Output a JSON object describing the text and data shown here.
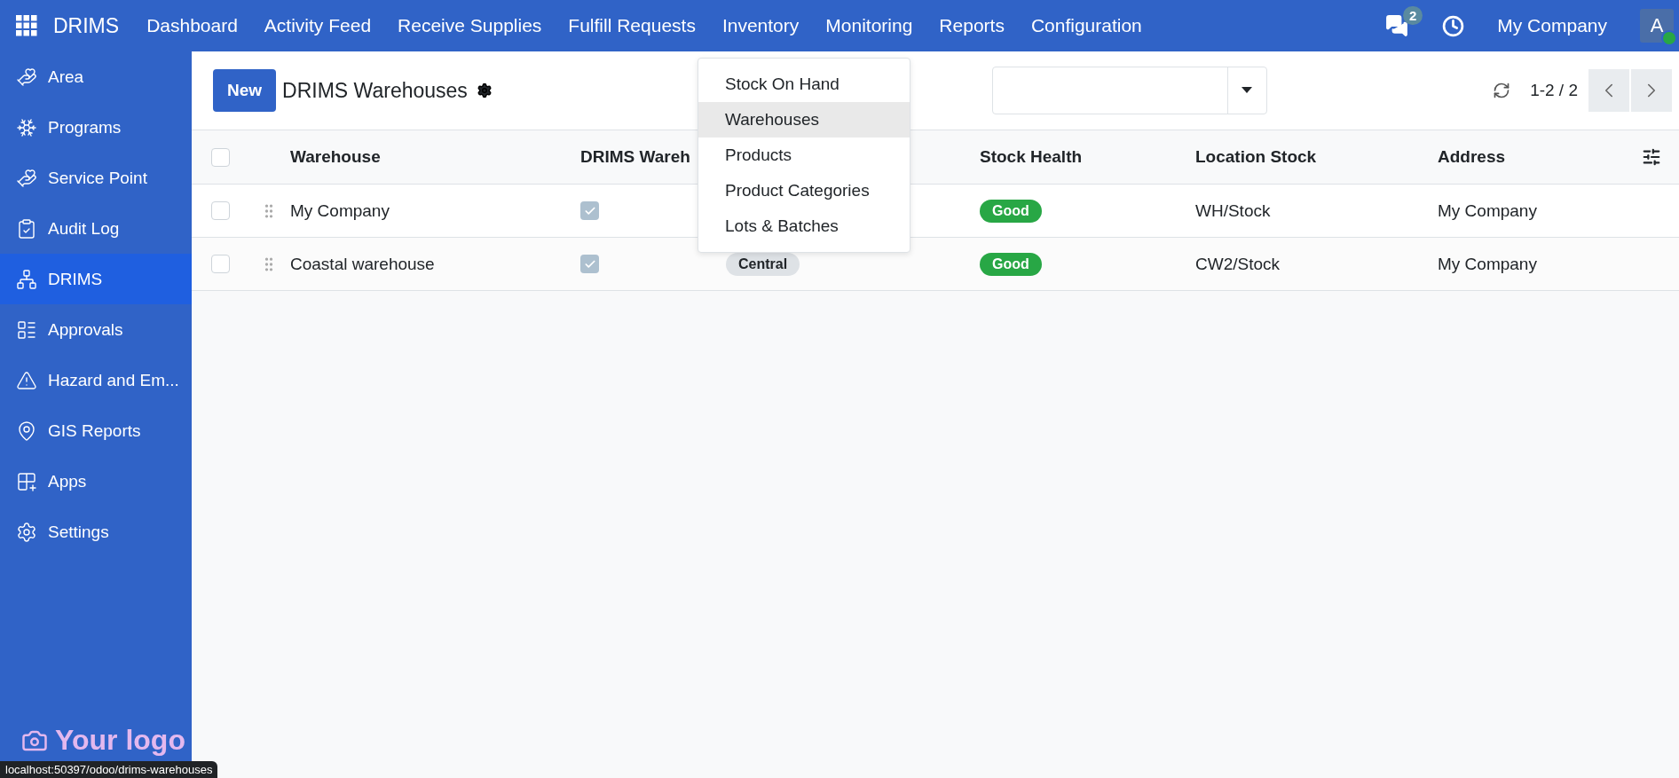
{
  "navbar": {
    "app_name": "DRIMS",
    "menu": [
      "Dashboard",
      "Activity Feed",
      "Receive Supplies",
      "Fulfill Requests",
      "Inventory",
      "Monitoring",
      "Reports",
      "Configuration"
    ],
    "message_count": "2",
    "company": "My Company",
    "avatar": "A"
  },
  "sidebar": {
    "items": [
      {
        "label": "Area",
        "selected": false
      },
      {
        "label": "Programs",
        "selected": false
      },
      {
        "label": "Service Point",
        "selected": false
      },
      {
        "label": "Audit Log",
        "selected": false
      },
      {
        "label": "DRIMS",
        "selected": true
      },
      {
        "label": "Approvals",
        "selected": false
      },
      {
        "label": "Hazard and Em...",
        "selected": false
      },
      {
        "label": "GIS Reports",
        "selected": false
      },
      {
        "label": "Apps",
        "selected": false
      },
      {
        "label": "Settings",
        "selected": false
      }
    ],
    "logo": "Your logo"
  },
  "control_panel": {
    "new_button": "New",
    "title": "DRIMS Warehouses",
    "pager": "1-2 / 2"
  },
  "dropdown": {
    "items": [
      {
        "label": "Stock On Hand",
        "selected": false
      },
      {
        "label": "Warehouses",
        "selected": true
      },
      {
        "label": "Products",
        "selected": false
      },
      {
        "label": "Product Categories",
        "selected": false
      },
      {
        "label": "Lots & Batches",
        "selected": false
      }
    ]
  },
  "table": {
    "select_all_checked": false,
    "columns": [
      "Warehouse",
      "DRIMS Wareh",
      "Stock Health",
      "Location Stock",
      "Address"
    ],
    "rows": [
      {
        "selected": false,
        "warehouse": "My Company",
        "drims_warehouse": true,
        "stock_health": "Good",
        "location_stock": "WH/Stock",
        "address": "My Company"
      },
      {
        "selected": false,
        "warehouse": "Coastal warehouse",
        "drims_warehouse": true,
        "column_3": "Central",
        "stock_health": "Good",
        "location_stock": "CW2/Stock",
        "address": "My Company"
      }
    ]
  },
  "status_tooltip": "localhost:50397/odoo/drims-warehouses"
}
